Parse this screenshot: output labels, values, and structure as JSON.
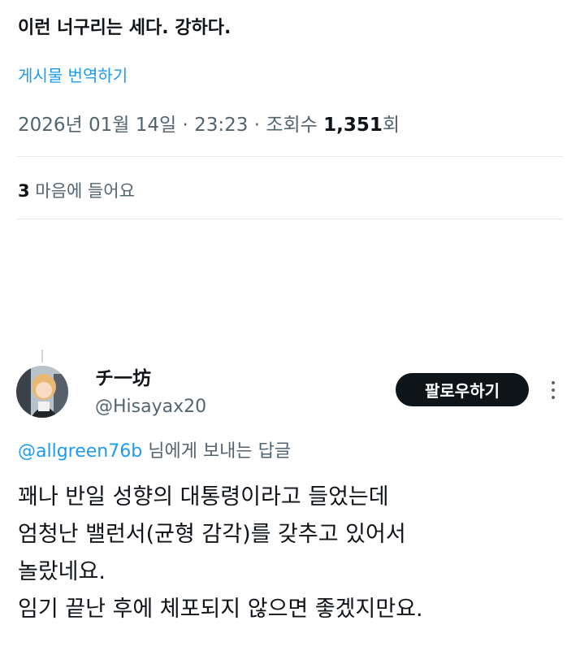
{
  "tweet": {
    "text": "이런 너구리는 세다. 강하다.",
    "translate_label": "게시물 번역하기",
    "timestamp": "2026년 01월 14일 · 23:23 · 조회수 ",
    "views_count": "1,351",
    "views_suffix": "회",
    "likes_count": "3",
    "likes_label": " 마음에 들어요"
  },
  "reply": {
    "display_name": "チ一坊",
    "handle": "@Hisayax20",
    "follow_label": "팔로우하기",
    "replying_to_handle": "@allgreen76b",
    "replying_to_suffix": " 님에게 보내는 답글",
    "lines": [
      "꽤나 반일 성향의 대통령이라고 들었는데",
      "엄청난 밸런서(균형 감각)를 갖추고 있어서",
      "놀랐네요.",
      "임기 끝난 후에 체포되지 않으면 좋겠지만요."
    ]
  },
  "icons": {
    "more": "more-options-icon"
  }
}
